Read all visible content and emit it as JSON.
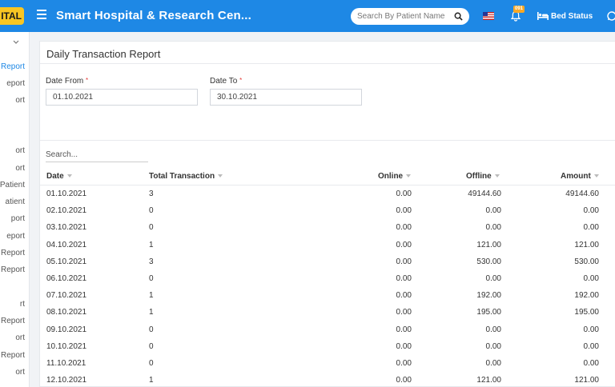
{
  "header": {
    "logo_text": "ITAL",
    "app_title": "Smart Hospital & Research Cen...",
    "search_placeholder": "Search By Patient Name",
    "notification_count": "091",
    "bed_status_label": "Bed Status"
  },
  "sidebar": {
    "items": [
      "Report",
      "eport",
      "ort",
      "ort",
      "ort",
      "Patient",
      "atient",
      "port",
      "eport",
      "t Report",
      "Report",
      "rt",
      "Report",
      "ort",
      "Report",
      "ort"
    ]
  },
  "report": {
    "title": "Daily Transaction Report",
    "date_from_label": "Date From",
    "date_from_value": "01.10.2021",
    "date_to_label": "Date To",
    "date_to_value": "30.10.2021",
    "search_placeholder": "Search...",
    "columns": [
      "Date",
      "Total Transaction",
      "Online",
      "Offline",
      "Amount"
    ],
    "rows": [
      [
        "01.10.2021",
        "3",
        "0.00",
        "49144.60",
        "49144.60"
      ],
      [
        "02.10.2021",
        "0",
        "0.00",
        "0.00",
        "0.00"
      ],
      [
        "03.10.2021",
        "0",
        "0.00",
        "0.00",
        "0.00"
      ],
      [
        "04.10.2021",
        "1",
        "0.00",
        "121.00",
        "121.00"
      ],
      [
        "05.10.2021",
        "3",
        "0.00",
        "530.00",
        "530.00"
      ],
      [
        "06.10.2021",
        "0",
        "0.00",
        "0.00",
        "0.00"
      ],
      [
        "07.10.2021",
        "1",
        "0.00",
        "192.00",
        "192.00"
      ],
      [
        "08.10.2021",
        "1",
        "0.00",
        "195.00",
        "195.00"
      ],
      [
        "09.10.2021",
        "0",
        "0.00",
        "0.00",
        "0.00"
      ],
      [
        "10.10.2021",
        "0",
        "0.00",
        "0.00",
        "0.00"
      ],
      [
        "11.10.2021",
        "0",
        "0.00",
        "0.00",
        "0.00"
      ],
      [
        "12.10.2021",
        "1",
        "0.00",
        "121.00",
        "121.00"
      ]
    ]
  },
  "icons": {
    "menu": "hamburger-icon",
    "search": "search-icon",
    "language": "us-flag-icon",
    "notifications": "bell-icon",
    "bed": "bed-icon",
    "chat": "chat-icon"
  },
  "colors": {
    "header_bg": "#1e88e5",
    "logo_bg": "#f9c623",
    "required": "#e53935"
  }
}
